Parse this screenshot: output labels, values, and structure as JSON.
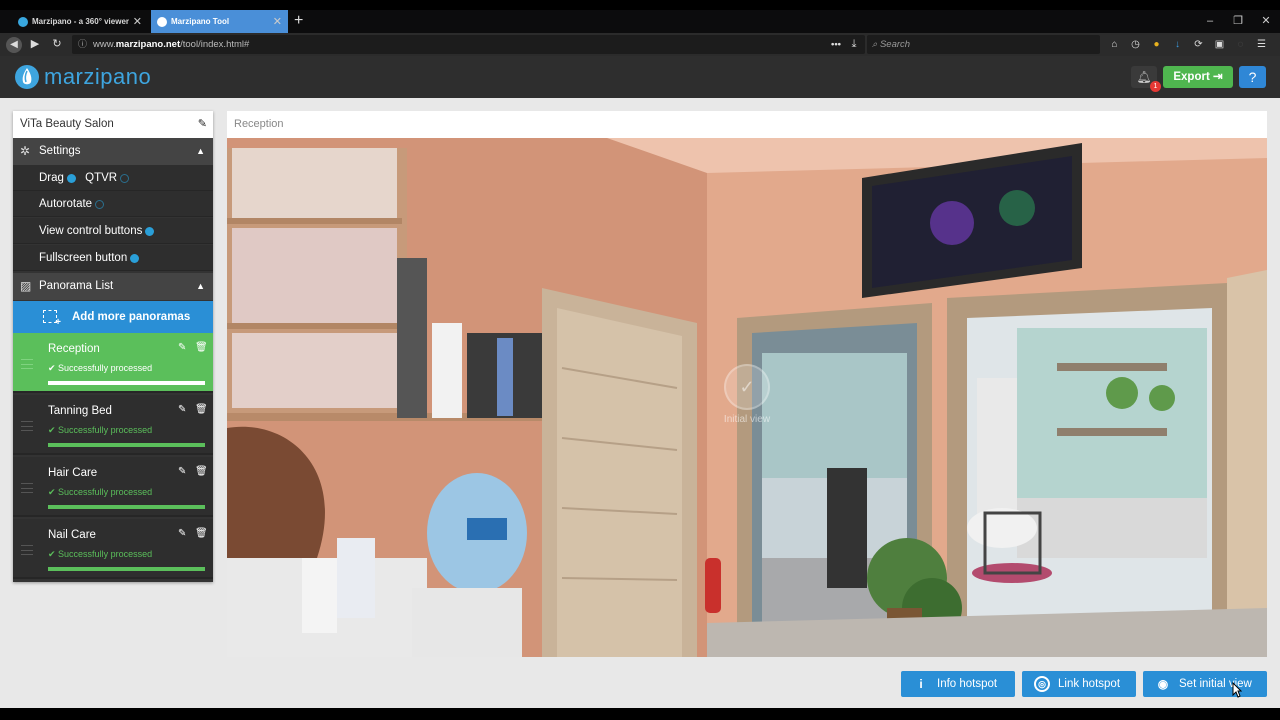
{
  "browser": {
    "tabs": [
      {
        "title": "Marzipano - a 360° viewer f",
        "close": "✕"
      },
      {
        "title": "Marzipano Tool",
        "close": "✕"
      }
    ],
    "new_tab": "+",
    "window_controls": [
      "‒",
      "❐",
      "✕"
    ],
    "url": {
      "prefix": "www.",
      "domain": "marzipano.net",
      "path": "/tool/index.html#",
      "more": "•••"
    },
    "search_placeholder": "Search"
  },
  "app": {
    "logo_text": "marzipano",
    "notification_count": "1",
    "export_label": "Export",
    "help_label": "?"
  },
  "sidebar": {
    "project_name": "ViTa Beauty Salon",
    "settings_title": "Settings",
    "settings": {
      "drag_label": "Drag",
      "qtvr_label": "QTVR",
      "autorotate_label": "Autorotate",
      "view_control_label": "View control buttons",
      "fullscreen_label": "Fullscreen button"
    },
    "panorama_list_title": "Panorama List",
    "add_more_label": "Add more panoramas",
    "panoramas": [
      {
        "name": "Reception",
        "status": "Successfully processed",
        "progress": 1.0
      },
      {
        "name": "Tanning Bed",
        "status": "Successfully processed",
        "progress": 1.0
      },
      {
        "name": "Hair Care",
        "status": "Successfully processed",
        "progress": 1.0
      },
      {
        "name": "Nail Care",
        "status": "Successfully processed",
        "progress": 1.0
      }
    ]
  },
  "viewer": {
    "title": "Reception",
    "initial_view_label": "Initial view"
  },
  "actions": {
    "info_hotspot": "Info hotspot",
    "link_hotspot": "Link hotspot",
    "set_initial_view": "Set initial view"
  },
  "colors": {
    "brand_blue": "#2a8fd6",
    "success_green": "#5bbf5b",
    "export_green": "#4fb64f",
    "badge_red": "#e53935"
  }
}
